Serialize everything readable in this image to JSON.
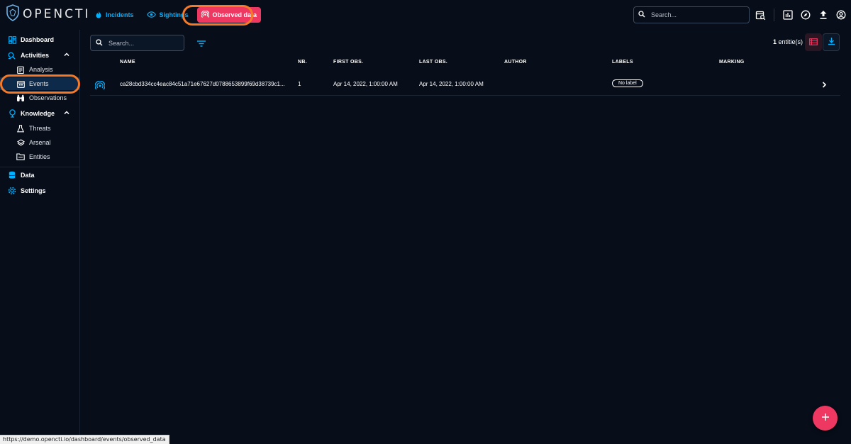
{
  "app": {
    "brand": "OPENCTI"
  },
  "topnav": {
    "items": [
      {
        "label": "Incidents",
        "icon": "fire-icon",
        "active": false
      },
      {
        "label": "Sightings",
        "icon": "eye-icon",
        "active": false
      },
      {
        "label": "Observed data",
        "icon": "broadcast-icon",
        "active": true
      }
    ]
  },
  "top_search": {
    "placeholder": "Search..."
  },
  "top_icons": [
    "search-calendar-icon",
    "dashboard-chart-icon",
    "explore-compass-icon",
    "import-upload-icon",
    "account-icon"
  ],
  "sidebar": {
    "items": [
      {
        "label": "Dashboard",
        "icon": "dashboard-icon"
      },
      {
        "label": "Activities",
        "icon": "activities-icon",
        "expanded": true
      },
      {
        "label": "Analysis",
        "icon": "analysis-icon",
        "sub": true
      },
      {
        "label": "Events",
        "icon": "events-icon",
        "sub": true,
        "selected": true
      },
      {
        "label": "Observations",
        "icon": "binoculars-icon",
        "sub": true
      },
      {
        "label": "Knowledge",
        "icon": "knowledge-icon",
        "expanded": true
      },
      {
        "label": "Threats",
        "icon": "threats-flask-icon",
        "sub": true
      },
      {
        "label": "Arsenal",
        "icon": "arsenal-layers-icon",
        "sub": true
      },
      {
        "label": "Entities",
        "icon": "entities-folder-icon",
        "sub": true
      },
      {
        "label": "Data",
        "icon": "database-icon"
      },
      {
        "label": "Settings",
        "icon": "settings-gear-icon"
      }
    ]
  },
  "main": {
    "search_placeholder": "Search...",
    "entity_count": "1",
    "entity_count_suffix": " entitie(s)"
  },
  "table": {
    "columns": [
      "NAME",
      "NB.",
      "FIRST OBS.",
      "LAST OBS.",
      "AUTHOR",
      "LABELS",
      "MARKING"
    ],
    "rows": [
      {
        "name": "ca28cbd334cc4eac84c51a71e67627d0788653899f69d38739c1...",
        "nb": "1",
        "first_obs": "Apr 14, 2022, 1:00:00 AM",
        "last_obs": "Apr 14, 2022, 1:00:00 AM",
        "author": "",
        "label": "No label",
        "marking": ""
      }
    ]
  },
  "status_bar": {
    "url": "https://demo.opencti.io/dashboard/events/observed_data"
  },
  "colors": {
    "accent": "#00b1ff",
    "primary": "#ee3862",
    "background": "#070d19",
    "highlight_ring": "#f47a2a"
  }
}
